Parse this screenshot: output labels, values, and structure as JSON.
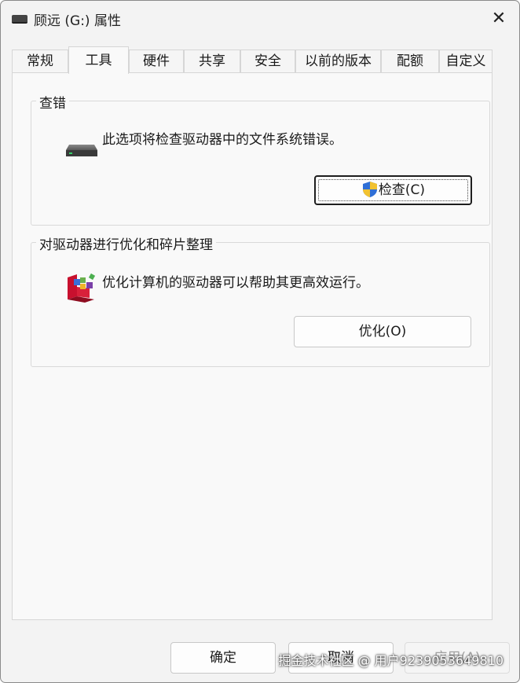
{
  "window": {
    "title": "顾远 (G:) 属性",
    "close_glyph": "✕"
  },
  "tabs": [
    {
      "label": "常规",
      "active": false
    },
    {
      "label": "工具",
      "active": true
    },
    {
      "label": "硬件",
      "active": false
    },
    {
      "label": "共享",
      "active": false
    },
    {
      "label": "安全",
      "active": false
    },
    {
      "label": "以前的版本",
      "active": false
    },
    {
      "label": "配额",
      "active": false
    },
    {
      "label": "自定义",
      "active": false
    }
  ],
  "error_check": {
    "legend": "查错",
    "description": "此选项将检查驱动器中的文件系统错误。",
    "button_label": "检查(C)",
    "button_icon": "uac-shield-icon",
    "icon": "drive-icon"
  },
  "optimize": {
    "legend": "对驱动器进行优化和碎片整理",
    "description": "优化计算机的驱动器可以帮助其更高效运行。",
    "button_label": "优化(O)",
    "icon": "defrag-icon"
  },
  "footer": {
    "ok_label": "确定",
    "cancel_label": "取消",
    "apply_label": "应用(A)"
  },
  "watermark": "掘金技术社区 @ 用户9239053649810",
  "colors": {
    "window_bg": "#f3f3f3",
    "panel_bg": "#f9f9f9",
    "shield_blue": "#2f6fd6",
    "shield_yellow": "#f2c230"
  }
}
